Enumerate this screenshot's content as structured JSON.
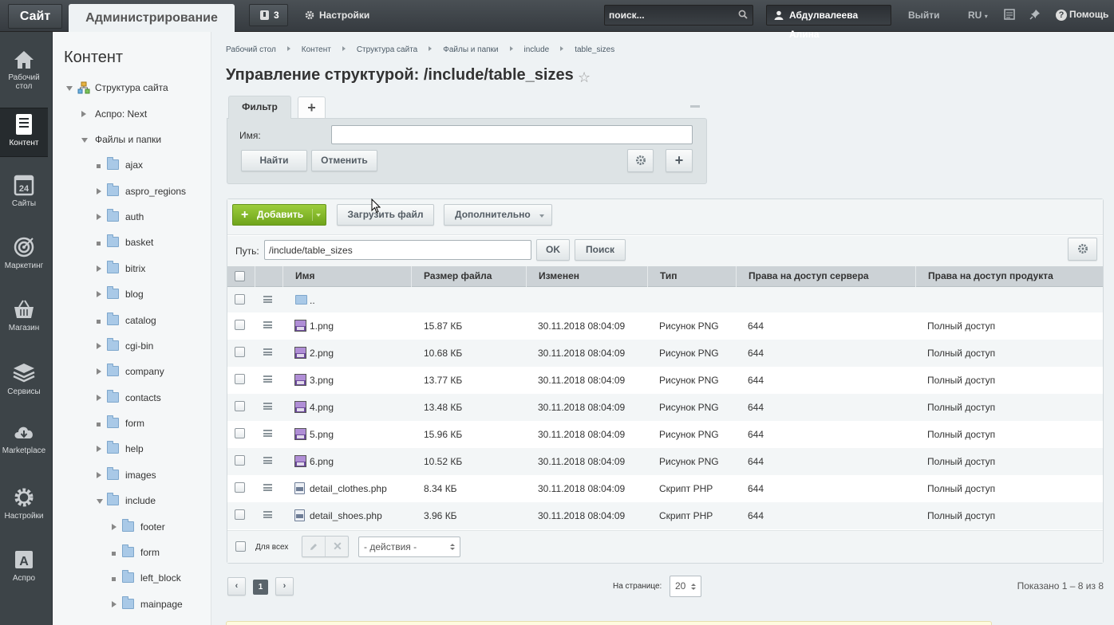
{
  "topbar": {
    "site_tab": "Сайт",
    "admin_tab": "Администрирование",
    "notifications_count": "3",
    "settings_label": "Настройки",
    "search_placeholder": "поиск...",
    "user_name": "Абдулвалеева Алина",
    "logout_label": "Выйти",
    "language": "RU",
    "help_label": "Помощь"
  },
  "leftnav": {
    "items": [
      {
        "label": "Рабочий стол",
        "icon": "home-icon"
      },
      {
        "label": "Контент",
        "icon": "document-icon"
      },
      {
        "label": "Сайты",
        "icon": "calendar-icon"
      },
      {
        "label": "Маркетинг",
        "icon": "target-icon"
      },
      {
        "label": "Магазин",
        "icon": "basket-icon"
      },
      {
        "label": "Сервисы",
        "icon": "layers-icon"
      },
      {
        "label": "Marketplace",
        "icon": "cloud-download-icon"
      },
      {
        "label": "Настройки",
        "icon": "gear-icon"
      },
      {
        "label": "Аспро",
        "icon": "letter-a-icon"
      }
    ]
  },
  "tree": {
    "title": "Контент",
    "items": [
      {
        "label": "Структура сайта"
      },
      {
        "label": "Аспро: Next"
      },
      {
        "label": "Файлы и папки"
      },
      {
        "label": "ajax"
      },
      {
        "label": "aspro_regions"
      },
      {
        "label": "auth"
      },
      {
        "label": "basket"
      },
      {
        "label": "bitrix"
      },
      {
        "label": "blog"
      },
      {
        "label": "catalog"
      },
      {
        "label": "cgi-bin"
      },
      {
        "label": "company"
      },
      {
        "label": "contacts"
      },
      {
        "label": "form"
      },
      {
        "label": "help"
      },
      {
        "label": "images"
      },
      {
        "label": "include"
      },
      {
        "label": "footer"
      },
      {
        "label": "form"
      },
      {
        "label": "left_block"
      },
      {
        "label": "mainpage"
      }
    ]
  },
  "breadcrumb": [
    "Рабочий стол",
    "Контент",
    "Структура сайта",
    "Файлы и папки",
    "include",
    "table_sizes"
  ],
  "page_title": "Управление структурой: /include/table_sizes",
  "filter": {
    "tab_label": "Фильтр",
    "add_tab": "+",
    "name_label": "Имя:",
    "name_value": "",
    "find_label": "Найти",
    "cancel_label": "Отменить",
    "plus_label": "+"
  },
  "toolbar": {
    "add_label": "Добавить",
    "upload_label": "Загрузить файл",
    "more_label": "Дополнительно",
    "path_label": "Путь:",
    "path_value": "/include/table_sizes",
    "ok_label": "OK",
    "search_label": "Поиск"
  },
  "table": {
    "columns": [
      "Имя",
      "Размер файла",
      "Изменен",
      "Тип",
      "Права на доступ сервера",
      "Права на доступ продукта"
    ],
    "up_row": "..",
    "rows": [
      {
        "name": "1.png",
        "size": "15.87 КБ",
        "modified": "30.11.2018 08:04:09",
        "type": "Рисунок PNG",
        "server": "644",
        "product": "Полный доступ",
        "icon": "png-file-icon"
      },
      {
        "name": "2.png",
        "size": "10.68 КБ",
        "modified": "30.11.2018 08:04:09",
        "type": "Рисунок PNG",
        "server": "644",
        "product": "Полный доступ",
        "icon": "png-file-icon"
      },
      {
        "name": "3.png",
        "size": "13.77 КБ",
        "modified": "30.11.2018 08:04:09",
        "type": "Рисунок PNG",
        "server": "644",
        "product": "Полный доступ",
        "icon": "png-file-icon"
      },
      {
        "name": "4.png",
        "size": "13.48 КБ",
        "modified": "30.11.2018 08:04:09",
        "type": "Рисунок PNG",
        "server": "644",
        "product": "Полный доступ",
        "icon": "png-file-icon"
      },
      {
        "name": "5.png",
        "size": "15.96 КБ",
        "modified": "30.11.2018 08:04:09",
        "type": "Рисунок PNG",
        "server": "644",
        "product": "Полный доступ",
        "icon": "png-file-icon"
      },
      {
        "name": "6.png",
        "size": "10.52 КБ",
        "modified": "30.11.2018 08:04:09",
        "type": "Рисунок PNG",
        "server": "644",
        "product": "Полный доступ",
        "icon": "png-file-icon"
      },
      {
        "name": "detail_clothes.php",
        "size": "8.34 КБ",
        "modified": "30.11.2018 08:04:09",
        "type": "Скрипт PHP",
        "server": "644",
        "product": "Полный доступ",
        "icon": "php-file-icon"
      },
      {
        "name": "detail_shoes.php",
        "size": "3.96 КБ",
        "modified": "30.11.2018 08:04:09",
        "type": "Скрипт PHP",
        "server": "644",
        "product": "Полный доступ",
        "icon": "php-file-icon"
      }
    ]
  },
  "footer": {
    "for_all_label": "Для всех",
    "actions_value": "- действия -",
    "current_page": "1",
    "per_page_label": "На странице:",
    "per_page_value": "20",
    "shown_text": "Показано 1 – 8 из 8"
  }
}
